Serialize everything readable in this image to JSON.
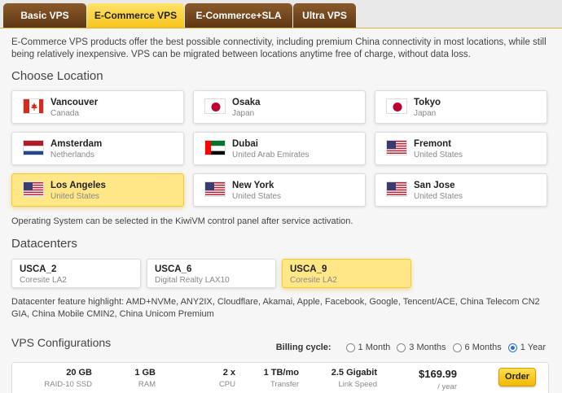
{
  "tabs": [
    {
      "label": "Basic VPS",
      "active": false
    },
    {
      "label": "E-Commerce VPS",
      "active": true
    },
    {
      "label": "E-Commerce+SLA",
      "active": false
    },
    {
      "label": "Ultra VPS",
      "active": false
    }
  ],
  "description": "E-Commerce VPS products offer the best possible connectivity, including premium China connectivity in most locations, while still being relatively inexpensive. VPS can be migrated between locations anytime free of charge, without data loss.",
  "location": {
    "title": "Choose Location",
    "items": [
      {
        "name": "Vancouver",
        "country": "Canada",
        "flag": "canada-flag-icon",
        "selected": false
      },
      {
        "name": "Osaka",
        "country": "Japan",
        "flag": "japan-flag-icon",
        "selected": false
      },
      {
        "name": "Tokyo",
        "country": "Japan",
        "flag": "japan-flag-icon",
        "selected": false
      },
      {
        "name": "Amsterdam",
        "country": "Netherlands",
        "flag": "netherlands-flag-icon",
        "selected": false
      },
      {
        "name": "Dubai",
        "country": "United Arab Emirates",
        "flag": "uae-flag-icon",
        "selected": false
      },
      {
        "name": "Fremont",
        "country": "United States",
        "flag": "usa-flag-icon",
        "selected": false
      },
      {
        "name": "Los Angeles",
        "country": "United States",
        "flag": "usa-flag-icon",
        "selected": true
      },
      {
        "name": "New York",
        "country": "United States",
        "flag": "usa-flag-icon",
        "selected": false
      },
      {
        "name": "San Jose",
        "country": "United States",
        "flag": "usa-flag-icon",
        "selected": false
      }
    ],
    "os_note": "Operating System can be selected in the KiwiVM control panel after service activation."
  },
  "datacenters": {
    "title": "Datacenters",
    "items": [
      {
        "name": "USCA_2",
        "provider": "Coresite LA2",
        "selected": false
      },
      {
        "name": "USCA_6",
        "provider": "Digital Realty LAX10",
        "selected": false
      },
      {
        "name": "USCA_9",
        "provider": "Coresite LA2",
        "selected": true
      }
    ],
    "highlight": "Datacenter feature highlight: AMD+NVMe, ANY2IX, Cloudflare, Akamai, Apple, Facebook, Google, Tencent/ACE, China Telecom CN2 GIA, China Mobile CMIN2, China Unicom Premium"
  },
  "configs": {
    "title": "VPS Configurations",
    "billing_label": "Billing cycle:",
    "billing_options": [
      {
        "label": "1 Month",
        "checked": false
      },
      {
        "label": "3 Months",
        "checked": false
      },
      {
        "label": "6 Months",
        "checked": false
      },
      {
        "label": "1 Year",
        "checked": true
      }
    ],
    "row": {
      "storage": "20 GB",
      "storage_label": "RAID-10 SSD",
      "ram": "1 GB",
      "ram_label": "RAM",
      "cpu": "2 x",
      "cpu_label": "CPU",
      "transfer": "1 TB/mo",
      "transfer_label": "Transfer",
      "speed": "2.5 Gigabit",
      "speed_label": "Link Speed",
      "price": "$169.99",
      "price_period": "/ year",
      "order_label": "Order"
    }
  },
  "colors": {
    "accent": "#f7c51b",
    "tab_brown": "#6e441c",
    "selected_card": "#ffe687"
  }
}
